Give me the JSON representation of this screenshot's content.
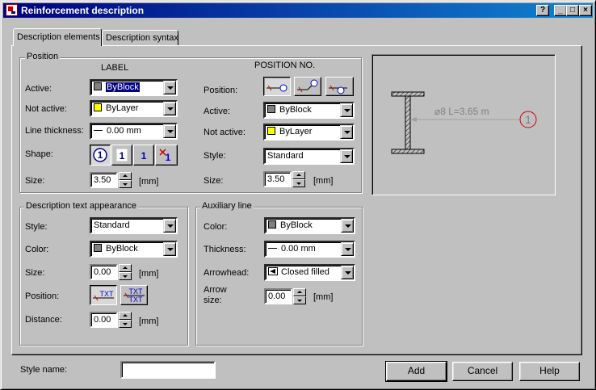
{
  "window": {
    "title": "Reinforcement description",
    "controls": {
      "help": "?",
      "minimize": "_",
      "maximize": "□",
      "close": "×"
    }
  },
  "tabs": [
    {
      "label": "Description elements",
      "active": true
    },
    {
      "label": "Description syntax",
      "active": false
    }
  ],
  "position_group": {
    "title": "Position",
    "label_column_header": "LABEL",
    "position_column_header": "POSITION NO.",
    "label": {
      "active": {
        "label": "Active:",
        "value": "ByBlock",
        "swatch": "#808080"
      },
      "not_active": {
        "label": "Not active:",
        "value": "ByLayer",
        "swatch": "#ffff00"
      },
      "line_thickness": {
        "label": "Line thickness:",
        "value": "0.00 mm"
      },
      "shape": {
        "label": "Shape:",
        "options": [
          "1",
          "1",
          "1",
          "1"
        ],
        "selected": 0
      },
      "size": {
        "label": "Size:",
        "value": "3.50",
        "unit": "[mm]"
      }
    },
    "position_no": {
      "position": {
        "label": "Position:",
        "selected": 0
      },
      "active": {
        "label": "Active:",
        "value": "ByBlock",
        "swatch": "#808080"
      },
      "not_active": {
        "label": "Not active:",
        "value": "ByLayer",
        "swatch": "#ffff00"
      },
      "style": {
        "label": "Style:",
        "value": "Standard"
      },
      "size": {
        "label": "Size:",
        "value": "3.50",
        "unit": "[mm]"
      }
    }
  },
  "text_appearance": {
    "title": "Description text appearance",
    "style": {
      "label": "Style:",
      "value": "Standard"
    },
    "color": {
      "label": "Color:",
      "value": "ByBlock",
      "swatch": "#808080"
    },
    "size": {
      "label": "Size:",
      "value": "0.00",
      "unit": "[mm]"
    },
    "position": {
      "label": "Position:",
      "option_text": "TXT",
      "selected": 0
    },
    "distance": {
      "label": "Distance:",
      "value": "0.00",
      "unit": "[mm]"
    }
  },
  "auxiliary_line": {
    "title": "Auxiliary line",
    "color": {
      "label": "Color:",
      "value": "ByBlock",
      "swatch": "#808080"
    },
    "thickness": {
      "label": "Thickness:",
      "value": "0.00 mm"
    },
    "arrowhead": {
      "label": "Arrowhead:",
      "value": "Closed filled"
    },
    "arrow_size": {
      "label_line1": "Arrow",
      "label_line2": "size:",
      "value": "0.00",
      "unit": "[mm]"
    }
  },
  "preview": {
    "label_text": "⌀8  L=3.65 m",
    "position_number": "1"
  },
  "footer": {
    "style_name_label": "Style name:",
    "style_name_value": "",
    "add": "Add",
    "cancel": "Cancel",
    "help": "Help"
  },
  "colors": {
    "title_bar": "#000080",
    "accent_red": "#cc0000",
    "accent_blue": "#0000cc",
    "face": "#c0c0c0"
  }
}
